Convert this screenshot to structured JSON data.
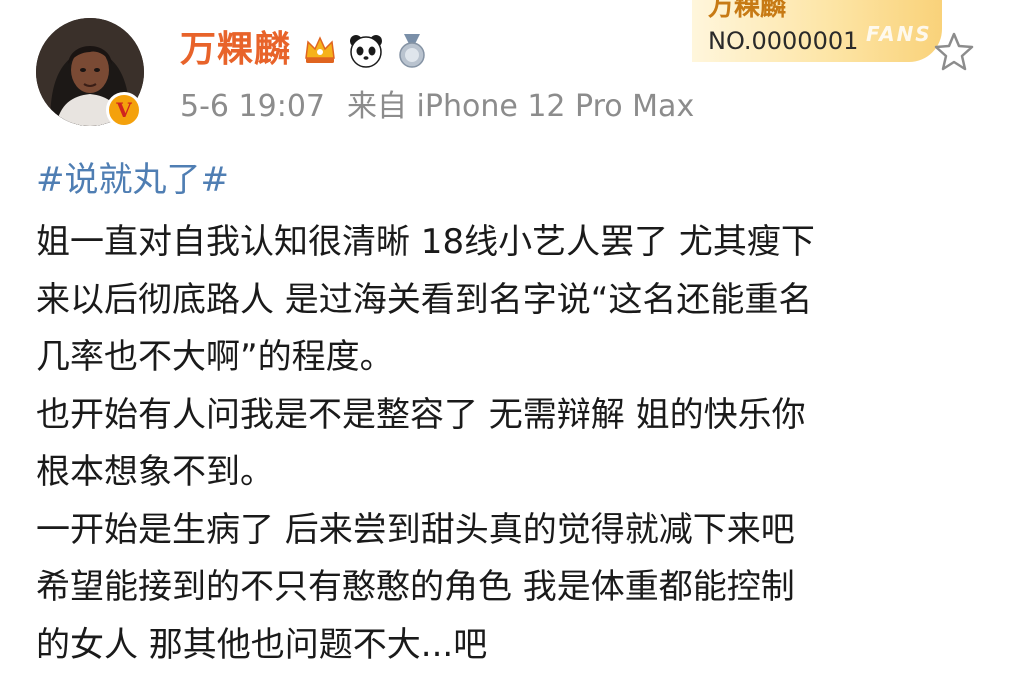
{
  "user": {
    "name": "万粿麟",
    "verified_mark": "V",
    "badges": [
      "crown-icon",
      "panda-icon",
      "medal-icon"
    ]
  },
  "meta": {
    "time": "5-6 19:07",
    "source": "来自 iPhone 12 Pro Max"
  },
  "fan_card": {
    "name": "万粿麟",
    "number": "NO.0000001",
    "label": "FANS"
  },
  "post": {
    "hashtag": "#说就丸了#",
    "lines": [
      "姐一直对自我认知很清晰 18线小艺人罢了 尤其瘦下",
      "来以后彻底路人 是过海关看到名字说“这名还能重名",
      "几率也不大啊”的程度。",
      "也开始有人问我是不是整容了 无需辩解 姐的快乐你",
      "根本想象不到。",
      "一开始是生病了 后来尝到甜头真的觉得就减下来吧",
      "希望能接到的不只有憨憨的角色 我是体重都能控制",
      "的女人 那其他也问题不大...吧"
    ]
  },
  "colors": {
    "username": "#e8632a",
    "hashtag": "#4f7eb3",
    "meta": "#8c8c8c",
    "badge": "#f4a10c"
  }
}
